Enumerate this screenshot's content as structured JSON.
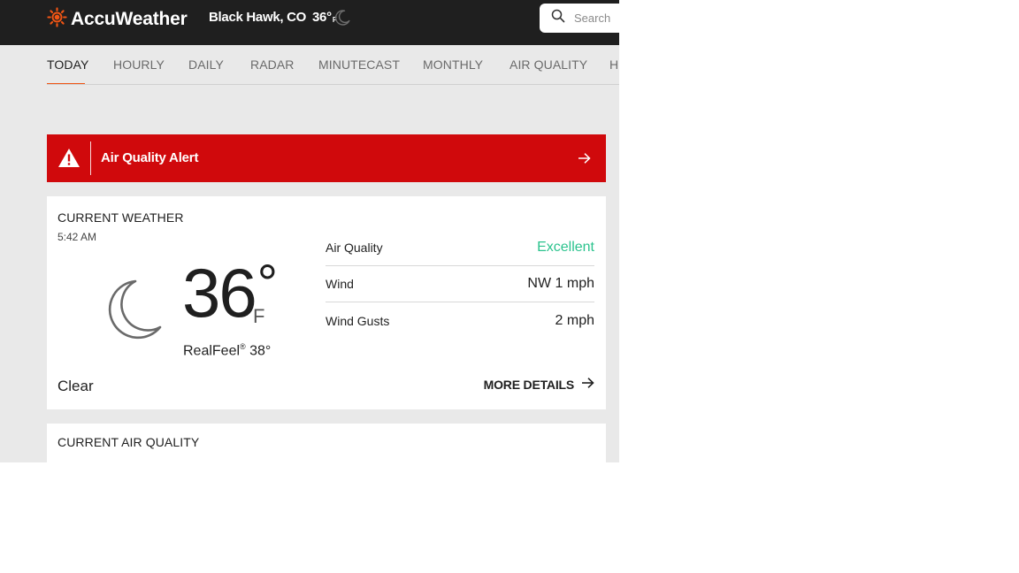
{
  "header": {
    "brand": "AccuWeather",
    "location": "Black Hawk, CO",
    "temp": "36°",
    "temp_unit": "F",
    "condition_icon": "moon-icon",
    "search_placeholder": "Search"
  },
  "nav": {
    "tabs": [
      {
        "label": "TODAY",
        "active": true
      },
      {
        "label": "HOURLY"
      },
      {
        "label": "DAILY"
      },
      {
        "label": "RADAR"
      },
      {
        "label": "MINUTECAST"
      },
      {
        "label": "MONTHLY"
      },
      {
        "label": "AIR QUALITY"
      },
      {
        "label": "H"
      }
    ]
  },
  "alert": {
    "label": "Air Quality Alert",
    "icon": "warning-icon",
    "color": "#d0090c"
  },
  "current": {
    "title": "CURRENT WEATHER",
    "time": "5:42 AM",
    "temp": "36",
    "degree": "°",
    "unit": "F",
    "realfeel_label": "RealFeel",
    "realfeel_value": "38°",
    "condition": "Clear",
    "details": [
      {
        "label": "Air Quality",
        "value": "Excellent",
        "color": "#2cc38e"
      },
      {
        "label": "Wind",
        "value": "NW 1 mph"
      },
      {
        "label": "Wind Gusts",
        "value": "2 mph"
      }
    ],
    "more_label": "MORE DETAILS"
  },
  "air_quality": {
    "title": "CURRENT AIR QUALITY"
  },
  "colors": {
    "accent": "#f05514",
    "header_bg": "#1f1f1f",
    "page_bg": "#e9e9e9"
  }
}
